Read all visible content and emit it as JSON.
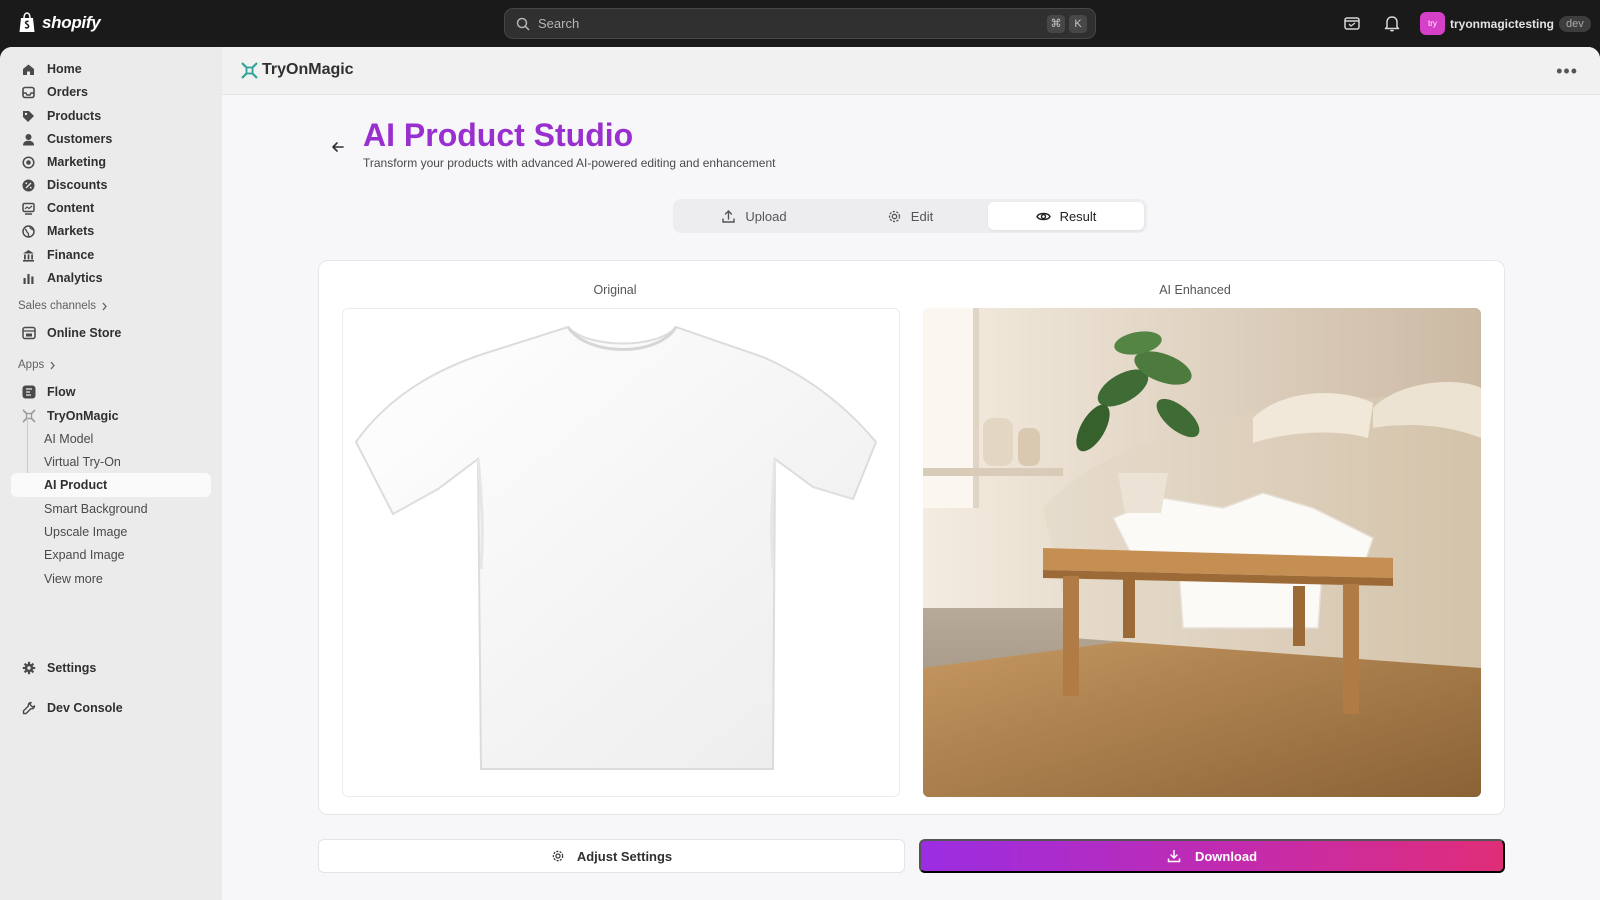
{
  "topbar": {
    "brand": "shopify",
    "search_placeholder": "Search",
    "shortcut_keys": [
      "⌘",
      "K"
    ],
    "user": {
      "avatar_initials": "try",
      "name": "tryonmagictesting",
      "badge": "dev"
    }
  },
  "sidebar": {
    "items": [
      {
        "label": "Home",
        "icon": "home-icon"
      },
      {
        "label": "Orders",
        "icon": "inbox-icon"
      },
      {
        "label": "Products",
        "icon": "tag-icon"
      },
      {
        "label": "Customers",
        "icon": "person-icon"
      },
      {
        "label": "Marketing",
        "icon": "target-icon"
      },
      {
        "label": "Discounts",
        "icon": "discount-icon"
      },
      {
        "label": "Content",
        "icon": "content-icon"
      },
      {
        "label": "Markets",
        "icon": "globe-icon"
      },
      {
        "label": "Finance",
        "icon": "bank-icon"
      },
      {
        "label": "Analytics",
        "icon": "bar-chart-icon"
      }
    ],
    "sales_channels_label": "Sales channels",
    "online_store_label": "Online Store",
    "apps_label": "Apps",
    "flow_label": "Flow",
    "tryonmagic_label": "TryOnMagic",
    "sub_items": [
      "AI Model",
      "Virtual Try-On",
      "AI Product",
      "Smart Background",
      "Upscale Image",
      "Expand Image",
      "View more"
    ],
    "active_sub_item": "AI Product",
    "settings_label": "Settings",
    "dev_console_label": "Dev Console"
  },
  "app": {
    "title": "TryOnMagic",
    "more_label": "•••"
  },
  "page": {
    "title": "AI Product Studio",
    "subtitle": "Transform your products with advanced AI-powered editing and enhancement",
    "tabs": [
      {
        "label": "Upload",
        "icon": "upload-icon"
      },
      {
        "label": "Edit",
        "icon": "gear-icon"
      },
      {
        "label": "Result",
        "icon": "eye-icon"
      }
    ],
    "active_tab": "Result",
    "original_label": "Original",
    "enhanced_label": "AI Enhanced",
    "adjust_button": "Adjust Settings",
    "download_button": "Download"
  },
  "colors": {
    "title_purple": "#9a2fd0",
    "download_gradient_start": "#9a2de3",
    "download_gradient_end": "#e02d78",
    "topbar_bg": "#1a1a1a"
  }
}
